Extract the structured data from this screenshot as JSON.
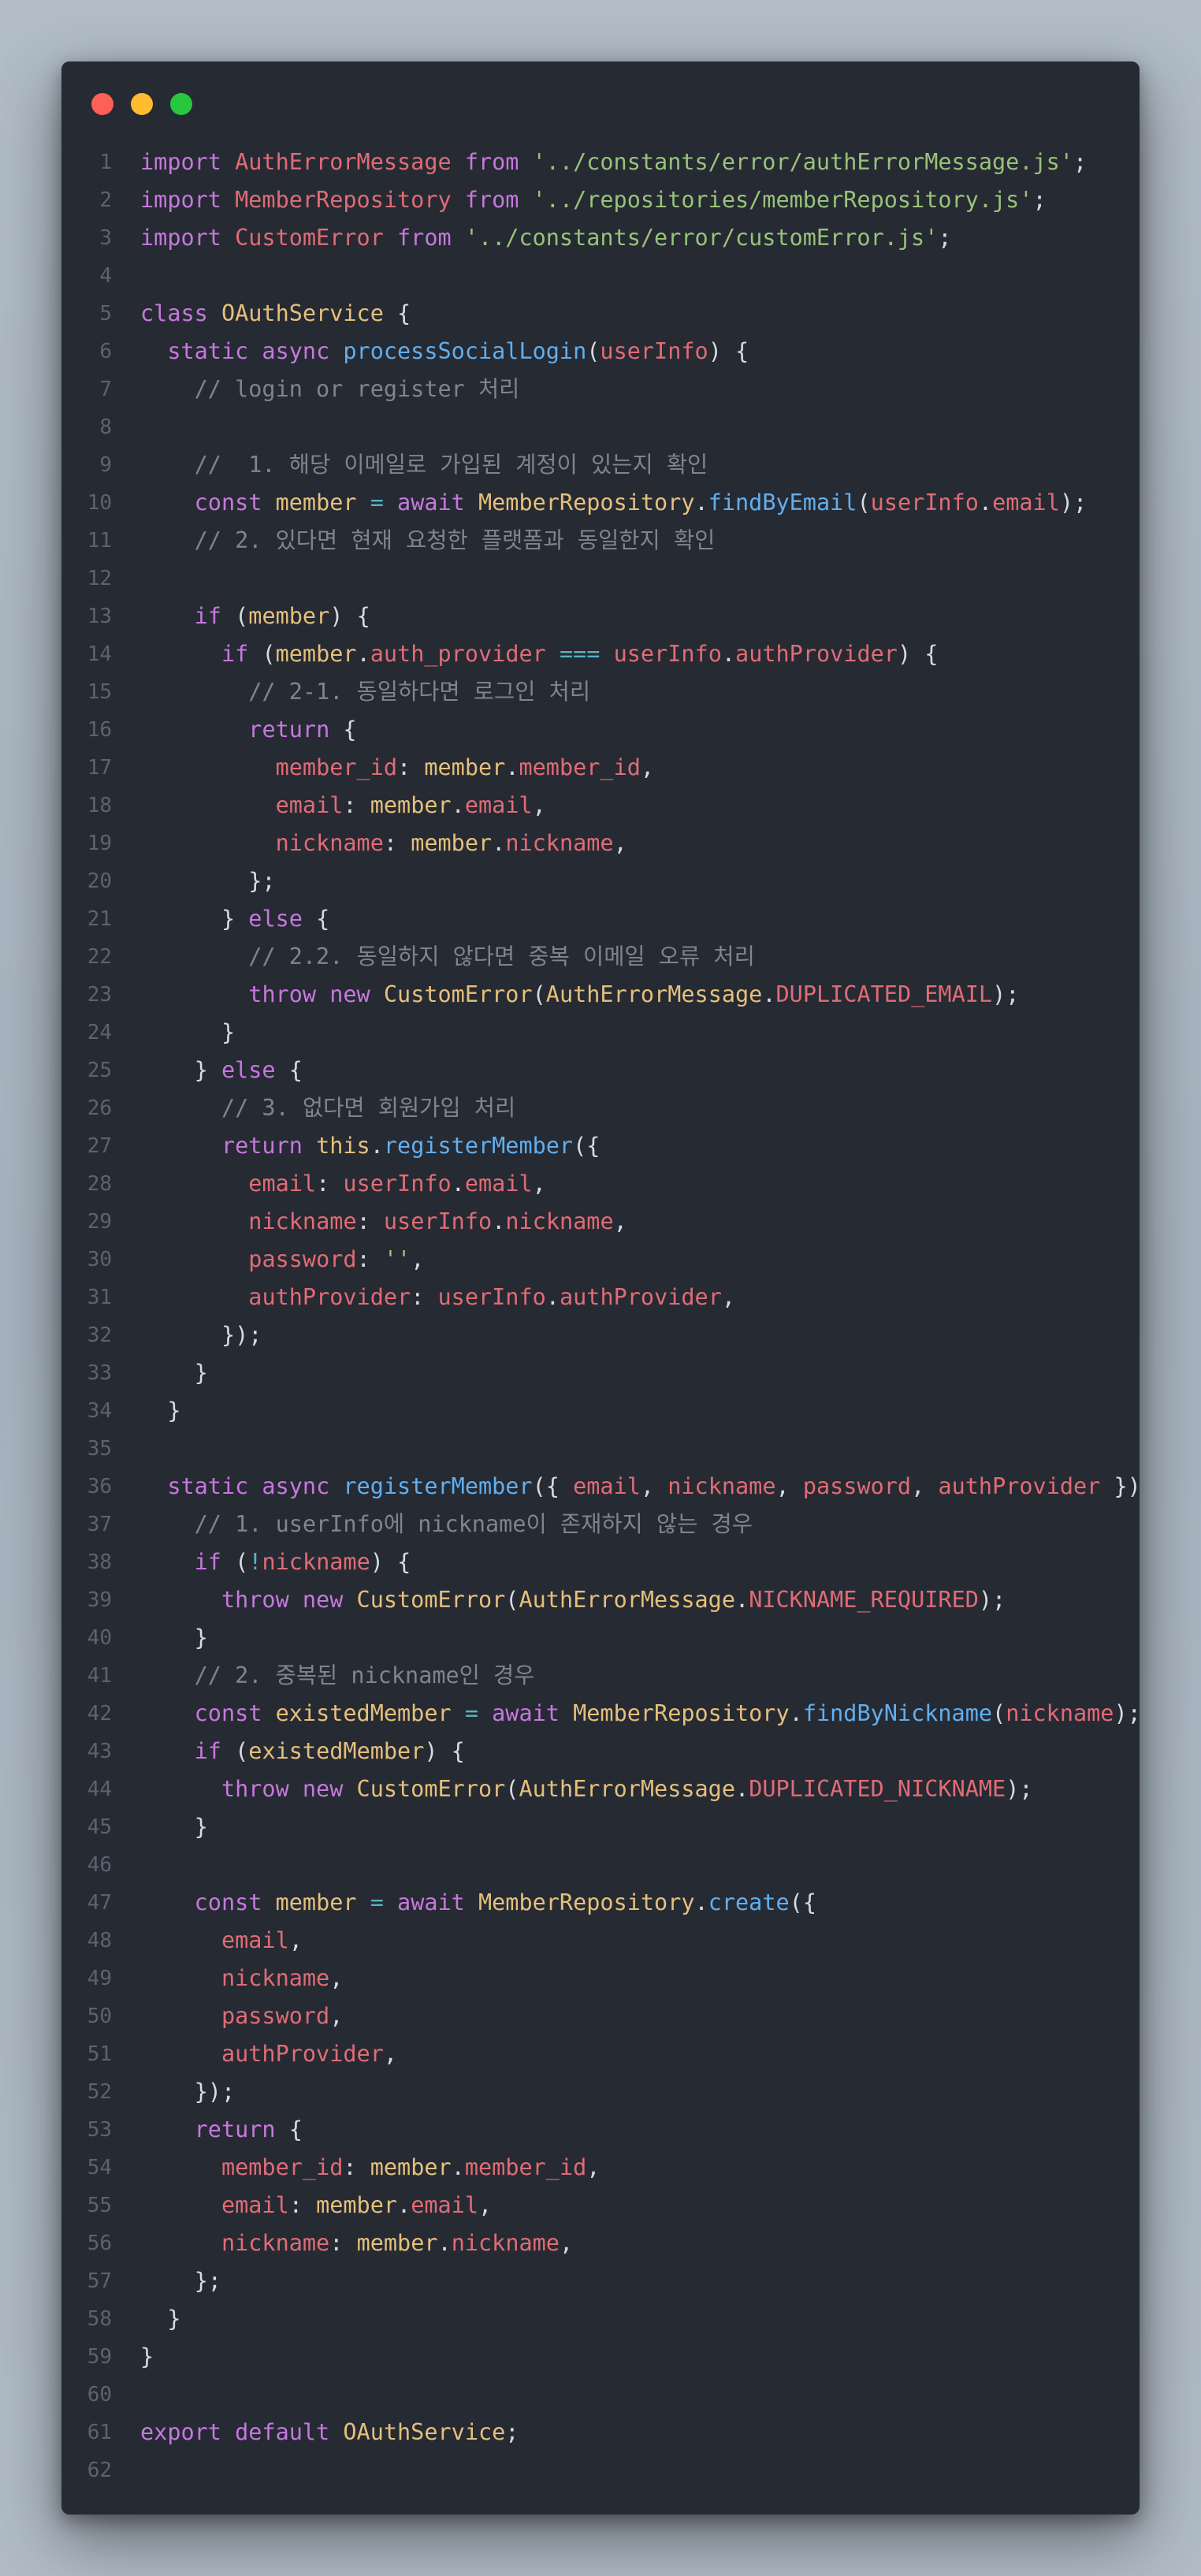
{
  "window": {
    "controls": [
      "close",
      "minimize",
      "zoom"
    ],
    "background": "#262a33"
  },
  "colors": {
    "keyword": "#c678dd",
    "class": "#e5c07b",
    "string": "#98c379",
    "function": "#61afef",
    "property": "#e06c75",
    "comment": "#7f848e",
    "operator": "#56b6c2",
    "plain": "#d7dae0",
    "line_number": "#5c6370"
  },
  "code": {
    "lines": [
      [
        [
          "kw",
          "import "
        ],
        [
          "prop",
          "AuthErrorMessage"
        ],
        [
          "kw",
          " from "
        ],
        [
          "str",
          "'../constants/error/authErrorMessage.js'"
        ],
        [
          "pl",
          ";"
        ]
      ],
      [
        [
          "kw",
          "import "
        ],
        [
          "prop",
          "MemberRepository"
        ],
        [
          "kw",
          " from "
        ],
        [
          "str",
          "'../repositories/memberRepository.js'"
        ],
        [
          "pl",
          ";"
        ]
      ],
      [
        [
          "kw",
          "import "
        ],
        [
          "prop",
          "CustomError"
        ],
        [
          "kw",
          " from "
        ],
        [
          "str",
          "'../constants/error/customError.js'"
        ],
        [
          "pl",
          ";"
        ]
      ],
      [],
      [
        [
          "kw",
          "class "
        ],
        [
          "cls",
          "OAuthService"
        ],
        [
          "pl",
          " {"
        ]
      ],
      [
        [
          "pl",
          "  "
        ],
        [
          "kw",
          "static async "
        ],
        [
          "fn",
          "processSocialLogin"
        ],
        [
          "pl",
          "("
        ],
        [
          "prop",
          "userInfo"
        ],
        [
          "pl",
          ") {"
        ]
      ],
      [
        [
          "cmt",
          "    // login or register 처리"
        ]
      ],
      [],
      [
        [
          "cmt",
          "    //  1. 해당 이메일로 가입된 계정이 있는지 확인"
        ]
      ],
      [
        [
          "pl",
          "    "
        ],
        [
          "kw",
          "const "
        ],
        [
          "cls",
          "member"
        ],
        [
          "op",
          " = "
        ],
        [
          "kw",
          "await "
        ],
        [
          "cls",
          "MemberRepository"
        ],
        [
          "pl",
          "."
        ],
        [
          "fn",
          "findByEmail"
        ],
        [
          "pl",
          "("
        ],
        [
          "prop",
          "userInfo"
        ],
        [
          "pl",
          "."
        ],
        [
          "prop",
          "email"
        ],
        [
          "pl",
          ");"
        ]
      ],
      [
        [
          "cmt",
          "    // 2. 있다면 현재 요청한 플랫폼과 동일한지 확인"
        ]
      ],
      [],
      [
        [
          "pl",
          "    "
        ],
        [
          "kw",
          "if "
        ],
        [
          "pl",
          "("
        ],
        [
          "cls",
          "member"
        ],
        [
          "pl",
          ") {"
        ]
      ],
      [
        [
          "pl",
          "      "
        ],
        [
          "kw",
          "if "
        ],
        [
          "pl",
          "("
        ],
        [
          "cls",
          "member"
        ],
        [
          "pl",
          "."
        ],
        [
          "prop",
          "auth_provider"
        ],
        [
          "op",
          " === "
        ],
        [
          "prop",
          "userInfo"
        ],
        [
          "pl",
          "."
        ],
        [
          "prop",
          "authProvider"
        ],
        [
          "pl",
          ") {"
        ]
      ],
      [
        [
          "cmt",
          "        // 2-1. 동일하다면 로그인 처리"
        ]
      ],
      [
        [
          "pl",
          "        "
        ],
        [
          "kw",
          "return "
        ],
        [
          "pl",
          "{"
        ]
      ],
      [
        [
          "pl",
          "          "
        ],
        [
          "prop",
          "member_id"
        ],
        [
          "pl",
          ": "
        ],
        [
          "cls",
          "member"
        ],
        [
          "pl",
          "."
        ],
        [
          "prop",
          "member_id"
        ],
        [
          "pl",
          ","
        ]
      ],
      [
        [
          "pl",
          "          "
        ],
        [
          "prop",
          "email"
        ],
        [
          "pl",
          ": "
        ],
        [
          "cls",
          "member"
        ],
        [
          "pl",
          "."
        ],
        [
          "prop",
          "email"
        ],
        [
          "pl",
          ","
        ]
      ],
      [
        [
          "pl",
          "          "
        ],
        [
          "prop",
          "nickname"
        ],
        [
          "pl",
          ": "
        ],
        [
          "cls",
          "member"
        ],
        [
          "pl",
          "."
        ],
        [
          "prop",
          "nickname"
        ],
        [
          "pl",
          ","
        ]
      ],
      [
        [
          "pl",
          "        };"
        ]
      ],
      [
        [
          "pl",
          "      } "
        ],
        [
          "kw",
          "else "
        ],
        [
          "pl",
          "{"
        ]
      ],
      [
        [
          "cmt",
          "        // 2.2. 동일하지 않다면 중복 이메일 오류 처리"
        ]
      ],
      [
        [
          "pl",
          "        "
        ],
        [
          "kw",
          "throw new "
        ],
        [
          "cls",
          "CustomError"
        ],
        [
          "pl",
          "("
        ],
        [
          "cls",
          "AuthErrorMessage"
        ],
        [
          "pl",
          "."
        ],
        [
          "prop",
          "DUPLICATED_EMAIL"
        ],
        [
          "pl",
          ");"
        ]
      ],
      [
        [
          "pl",
          "      }"
        ]
      ],
      [
        [
          "pl",
          "    } "
        ],
        [
          "kw",
          "else "
        ],
        [
          "pl",
          "{"
        ]
      ],
      [
        [
          "cmt",
          "      // 3. 없다면 회원가입 처리"
        ]
      ],
      [
        [
          "pl",
          "      "
        ],
        [
          "kw",
          "return "
        ],
        [
          "cls",
          "this"
        ],
        [
          "pl",
          "."
        ],
        [
          "fn",
          "registerMember"
        ],
        [
          "pl",
          "({"
        ]
      ],
      [
        [
          "pl",
          "        "
        ],
        [
          "prop",
          "email"
        ],
        [
          "pl",
          ": "
        ],
        [
          "prop",
          "userInfo"
        ],
        [
          "pl",
          "."
        ],
        [
          "prop",
          "email"
        ],
        [
          "pl",
          ","
        ]
      ],
      [
        [
          "pl",
          "        "
        ],
        [
          "prop",
          "nickname"
        ],
        [
          "pl",
          ": "
        ],
        [
          "prop",
          "userInfo"
        ],
        [
          "pl",
          "."
        ],
        [
          "prop",
          "nickname"
        ],
        [
          "pl",
          ","
        ]
      ],
      [
        [
          "pl",
          "        "
        ],
        [
          "prop",
          "password"
        ],
        [
          "pl",
          ": "
        ],
        [
          "str",
          "''"
        ],
        [
          "pl",
          ","
        ]
      ],
      [
        [
          "pl",
          "        "
        ],
        [
          "prop",
          "authProvider"
        ],
        [
          "pl",
          ": "
        ],
        [
          "prop",
          "userInfo"
        ],
        [
          "pl",
          "."
        ],
        [
          "prop",
          "authProvider"
        ],
        [
          "pl",
          ","
        ]
      ],
      [
        [
          "pl",
          "      });"
        ]
      ],
      [
        [
          "pl",
          "    }"
        ]
      ],
      [
        [
          "pl",
          "  }"
        ]
      ],
      [],
      [
        [
          "pl",
          "  "
        ],
        [
          "kw",
          "static async "
        ],
        [
          "fn",
          "registerMember"
        ],
        [
          "pl",
          "({ "
        ],
        [
          "prop",
          "email"
        ],
        [
          "pl",
          ", "
        ],
        [
          "prop",
          "nickname"
        ],
        [
          "pl",
          ", "
        ],
        [
          "prop",
          "password"
        ],
        [
          "pl",
          ", "
        ],
        [
          "prop",
          "authProvider"
        ],
        [
          "pl",
          " }) {"
        ]
      ],
      [
        [
          "cmt",
          "    // 1. userInfo에 nickname이 존재하지 않는 경우"
        ]
      ],
      [
        [
          "pl",
          "    "
        ],
        [
          "kw",
          "if "
        ],
        [
          "pl",
          "("
        ],
        [
          "op",
          "!"
        ],
        [
          "prop",
          "nickname"
        ],
        [
          "pl",
          ") {"
        ]
      ],
      [
        [
          "pl",
          "      "
        ],
        [
          "kw",
          "throw new "
        ],
        [
          "cls",
          "CustomError"
        ],
        [
          "pl",
          "("
        ],
        [
          "cls",
          "AuthErrorMessage"
        ],
        [
          "pl",
          "."
        ],
        [
          "prop",
          "NICKNAME_REQUIRED"
        ],
        [
          "pl",
          ");"
        ]
      ],
      [
        [
          "pl",
          "    }"
        ]
      ],
      [
        [
          "cmt",
          "    // 2. 중복된 nickname인 경우"
        ]
      ],
      [
        [
          "pl",
          "    "
        ],
        [
          "kw",
          "const "
        ],
        [
          "cls",
          "existedMember"
        ],
        [
          "op",
          " = "
        ],
        [
          "kw",
          "await "
        ],
        [
          "cls",
          "MemberRepository"
        ],
        [
          "pl",
          "."
        ],
        [
          "fn",
          "findByNickname"
        ],
        [
          "pl",
          "("
        ],
        [
          "prop",
          "nickname"
        ],
        [
          "pl",
          ");"
        ]
      ],
      [
        [
          "pl",
          "    "
        ],
        [
          "kw",
          "if "
        ],
        [
          "pl",
          "("
        ],
        [
          "cls",
          "existedMember"
        ],
        [
          "pl",
          ") {"
        ]
      ],
      [
        [
          "pl",
          "      "
        ],
        [
          "kw",
          "throw new "
        ],
        [
          "cls",
          "CustomError"
        ],
        [
          "pl",
          "("
        ],
        [
          "cls",
          "AuthErrorMessage"
        ],
        [
          "pl",
          "."
        ],
        [
          "prop",
          "DUPLICATED_NICKNAME"
        ],
        [
          "pl",
          ");"
        ]
      ],
      [
        [
          "pl",
          "    }"
        ]
      ],
      [],
      [
        [
          "pl",
          "    "
        ],
        [
          "kw",
          "const "
        ],
        [
          "cls",
          "member"
        ],
        [
          "op",
          " = "
        ],
        [
          "kw",
          "await "
        ],
        [
          "cls",
          "MemberRepository"
        ],
        [
          "pl",
          "."
        ],
        [
          "fn",
          "create"
        ],
        [
          "pl",
          "({"
        ]
      ],
      [
        [
          "pl",
          "      "
        ],
        [
          "prop",
          "email"
        ],
        [
          "pl",
          ","
        ]
      ],
      [
        [
          "pl",
          "      "
        ],
        [
          "prop",
          "nickname"
        ],
        [
          "pl",
          ","
        ]
      ],
      [
        [
          "pl",
          "      "
        ],
        [
          "prop",
          "password"
        ],
        [
          "pl",
          ","
        ]
      ],
      [
        [
          "pl",
          "      "
        ],
        [
          "prop",
          "authProvider"
        ],
        [
          "pl",
          ","
        ]
      ],
      [
        [
          "pl",
          "    });"
        ]
      ],
      [
        [
          "pl",
          "    "
        ],
        [
          "kw",
          "return "
        ],
        [
          "pl",
          "{"
        ]
      ],
      [
        [
          "pl",
          "      "
        ],
        [
          "prop",
          "member_id"
        ],
        [
          "pl",
          ": "
        ],
        [
          "cls",
          "member"
        ],
        [
          "pl",
          "."
        ],
        [
          "prop",
          "member_id"
        ],
        [
          "pl",
          ","
        ]
      ],
      [
        [
          "pl",
          "      "
        ],
        [
          "prop",
          "email"
        ],
        [
          "pl",
          ": "
        ],
        [
          "cls",
          "member"
        ],
        [
          "pl",
          "."
        ],
        [
          "prop",
          "email"
        ],
        [
          "pl",
          ","
        ]
      ],
      [
        [
          "pl",
          "      "
        ],
        [
          "prop",
          "nickname"
        ],
        [
          "pl",
          ": "
        ],
        [
          "cls",
          "member"
        ],
        [
          "pl",
          "."
        ],
        [
          "prop",
          "nickname"
        ],
        [
          "pl",
          ","
        ]
      ],
      [
        [
          "pl",
          "    };"
        ]
      ],
      [
        [
          "pl",
          "  }"
        ]
      ],
      [
        [
          "pl",
          "}"
        ]
      ],
      [],
      [
        [
          "kw",
          "export default "
        ],
        [
          "cls",
          "OAuthService"
        ],
        [
          "pl",
          ";"
        ]
      ],
      []
    ]
  }
}
